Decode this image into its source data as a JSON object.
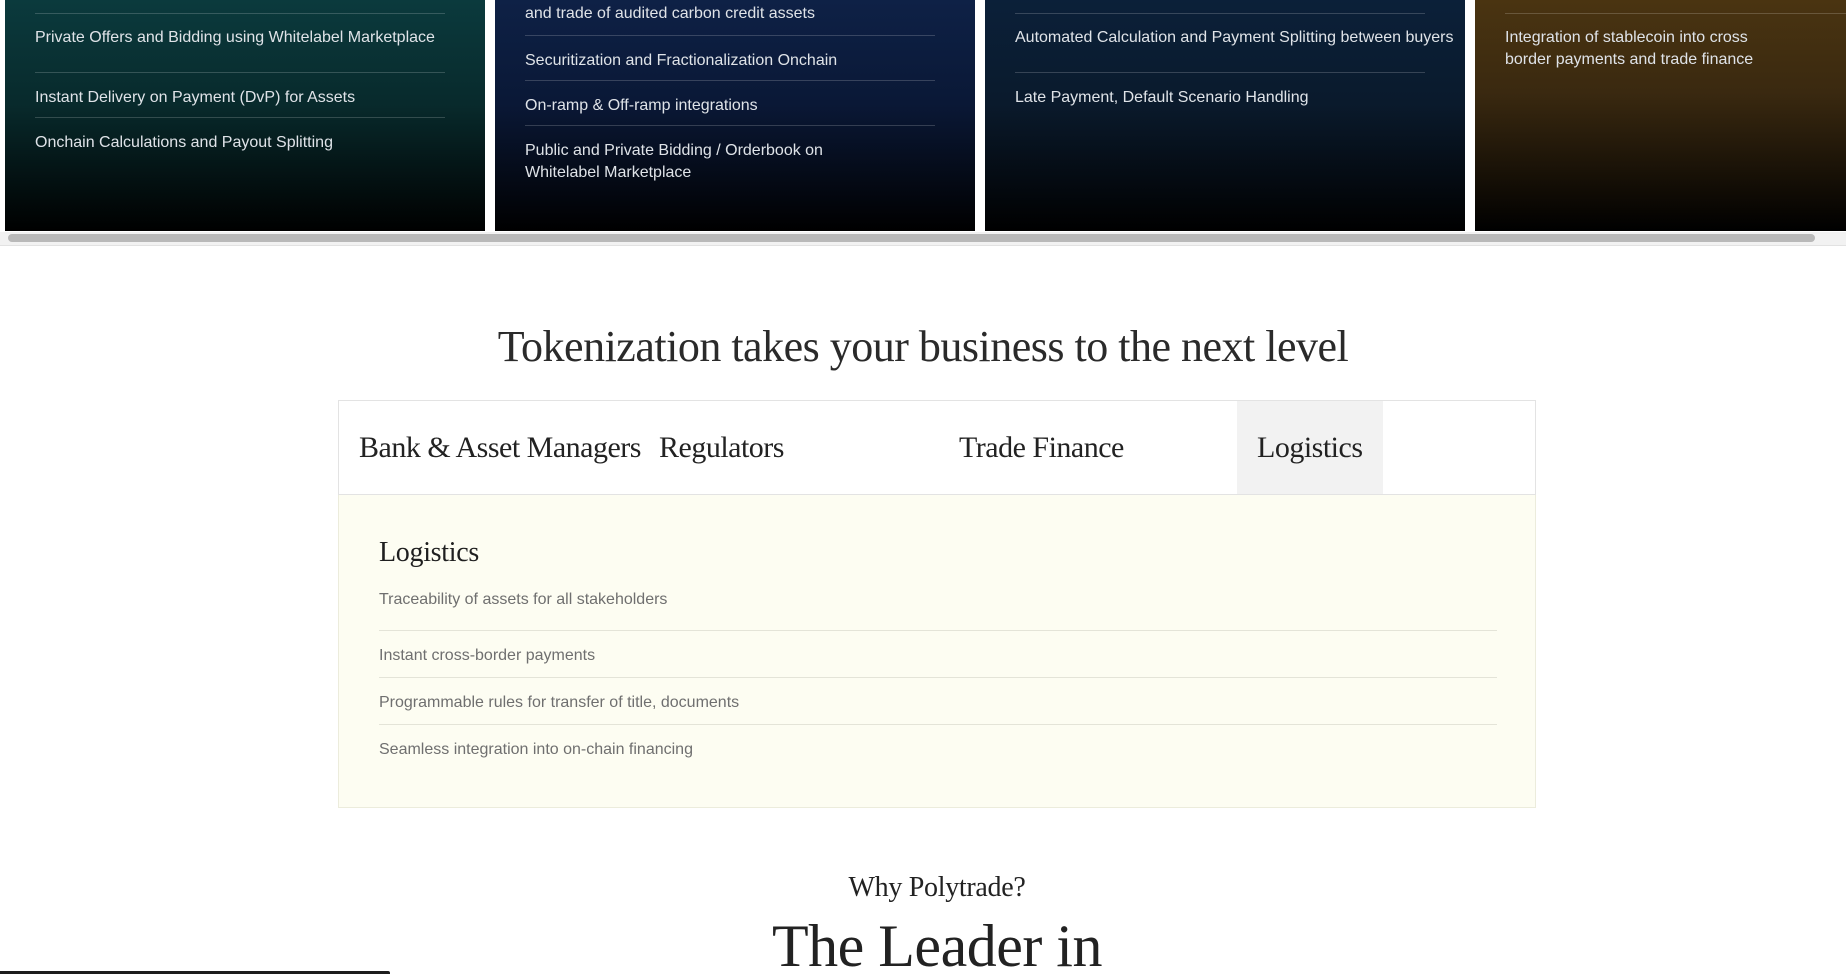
{
  "cards": [
    {
      "items": [
        "Private Offers and Bidding using Whitelabel Marketplace",
        "Instant Delivery on Payment (DvP) for Assets",
        "Onchain Calculations and Payout Splitting"
      ]
    },
    {
      "items": [
        "and trade of audited carbon credit assets",
        "Securitization and Fractionalization Onchain",
        "On-ramp & Off-ramp integrations",
        "Public and Private Bidding / Orderbook on Whitelabel Marketplace"
      ]
    },
    {
      "items": [
        "Automated Calculation and Payment Splitting between buyers",
        "Late Payment, Default Scenario Handling"
      ]
    },
    {
      "items": [
        "Integration of stablecoin into cross border payments and trade finance"
      ]
    }
  ],
  "section": {
    "title": "Tokenization takes your business to the next level"
  },
  "tabs": [
    {
      "label": "Bank & Asset Managers",
      "active": false
    },
    {
      "label": "Regulators",
      "active": false
    },
    {
      "label": "Trade Finance",
      "active": false
    },
    {
      "label": "Logistics",
      "active": true
    }
  ],
  "panel": {
    "title": "Logistics",
    "items": [
      "Traceability of assets for all stakeholders",
      "Instant cross-border payments",
      "Programmable rules for transfer of title, documents",
      "Seamless integration into on-chain financing"
    ]
  },
  "why": {
    "subtitle": "Why Polytrade?",
    "title": "The Leader in"
  },
  "colors": {
    "panel_bg": "#fdfdf2",
    "active_tab_bg": "#f2f2f2",
    "card_teal": "#0b3a3d",
    "card_navy": "#0e2146",
    "card_gold": "#4a3411"
  }
}
